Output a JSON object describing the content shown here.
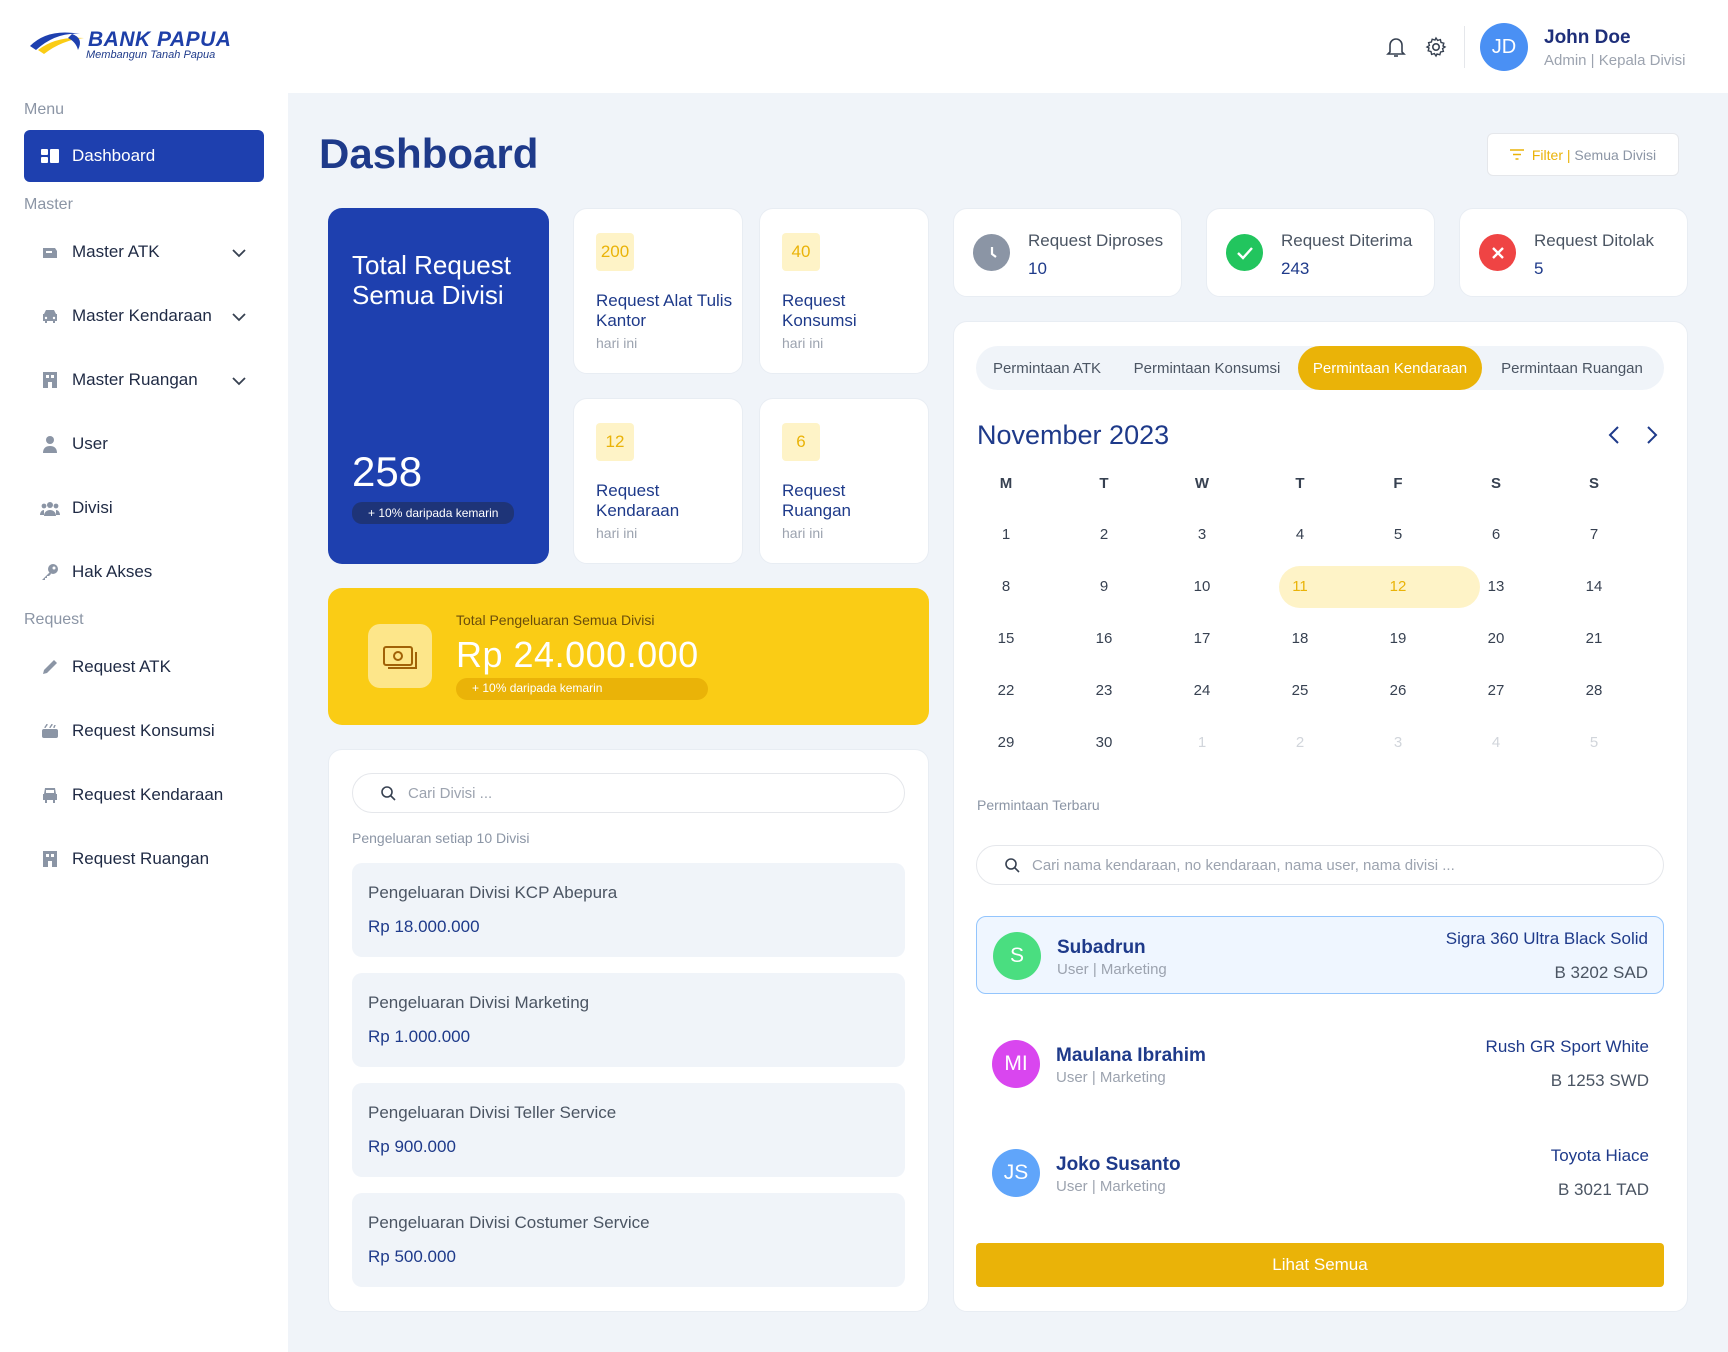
{
  "brand": {
    "name": "BANK PAPUA",
    "tagline": "Membangun Tanah Papua"
  },
  "user": {
    "initials": "JD",
    "name": "John Doe",
    "role": "Admin | Kepala Divisi"
  },
  "sidebar": {
    "menu_label": "Menu",
    "master_label": "Master",
    "request_label": "Request",
    "dashboard": "Dashboard",
    "master_items": [
      {
        "label": "Master ATK",
        "icon": "stapler-icon"
      },
      {
        "label": "Master Kendaraan",
        "icon": "car-icon"
      },
      {
        "label": "Master Ruangan",
        "icon": "building-icon"
      },
      {
        "label": "User",
        "icon": "user-icon"
      },
      {
        "label": "Divisi",
        "icon": "group-icon"
      },
      {
        "label": "Hak Akses",
        "icon": "key-icon"
      }
    ],
    "request_items": [
      {
        "label": "Request ATK",
        "icon": "pencil-icon"
      },
      {
        "label": "Request Konsumsi",
        "icon": "food-icon"
      },
      {
        "label": "Request Kendaraan",
        "icon": "car-icon"
      },
      {
        "label": "Request Ruangan",
        "icon": "building-icon"
      }
    ]
  },
  "page": {
    "title": "Dashboard",
    "filter_label": "Filter",
    "filter_value": "Semua Divisi"
  },
  "total": {
    "title": "Total Request Semua Divisi",
    "value": "258",
    "delta": "+ 10% daripada kemarin"
  },
  "mini_cards": [
    {
      "count": "200",
      "label": "Request Alat Tulis Kantor",
      "sub": "hari ini"
    },
    {
      "count": "40",
      "label": "Request Konsumsi",
      "sub": "hari ini"
    },
    {
      "count": "12",
      "label": "Request Kendaraan",
      "sub": "hari ini"
    },
    {
      "count": "6",
      "label": "Request Ruangan",
      "sub": "hari ini"
    }
  ],
  "stats": [
    {
      "label": "Request Diproses",
      "value": "10",
      "icon": "clock-icon",
      "color": "#8b95a5"
    },
    {
      "label": "Request Diterima",
      "value": "243",
      "icon": "check-icon",
      "color": "#22c55e"
    },
    {
      "label": "Request Ditolak",
      "value": "5",
      "icon": "x-icon",
      "color": "#ef4444"
    }
  ],
  "spending": {
    "title": "Total Pengeluaran Semua Divisi",
    "value": "Rp 24.000.000",
    "delta": "+ 10% daripada kemarin"
  },
  "divisions": {
    "search_placeholder": "Cari Divisi ...",
    "caption": "Pengeluaran setiap 10 Divisi",
    "items": [
      {
        "name": "Pengeluaran Divisi KCP Abepura",
        "amount": "Rp 18.000.000"
      },
      {
        "name": "Pengeluaran Divisi Marketing",
        "amount": "Rp 1.000.000"
      },
      {
        "name": "Pengeluaran Divisi Teller Service",
        "amount": "Rp 900.000"
      },
      {
        "name": "Pengeluaran Divisi Costumer Service",
        "amount": "Rp 500.000"
      }
    ]
  },
  "tabs": [
    "Permintaan ATK",
    "Permintaan Konsumsi",
    "Permintaan Kendaraan",
    "Permintaan Ruangan"
  ],
  "active_tab": "Permintaan Kendaraan",
  "calendar": {
    "month": "November 2023",
    "weekdays": [
      "M",
      "T",
      "W",
      "T",
      "F",
      "S",
      "S"
    ],
    "weeks": [
      [
        "1",
        "2",
        "3",
        "4",
        "5",
        "6",
        "7"
      ],
      [
        "8",
        "9",
        "10",
        "11",
        "12",
        "13",
        "14"
      ],
      [
        "15",
        "16",
        "17",
        "18",
        "19",
        "20",
        "21"
      ],
      [
        "22",
        "23",
        "24",
        "25",
        "26",
        "27",
        "28"
      ],
      [
        "29",
        "30",
        "1",
        "2",
        "3",
        "4",
        "5"
      ]
    ],
    "highlighted": [
      "11",
      "12"
    ]
  },
  "recent": {
    "label": "Permintaan Terbaru",
    "search_placeholder": "Cari nama kendaraan, no kendaraan, nama user, nama divisi ...",
    "items": [
      {
        "initials": "S",
        "name": "Subadrun",
        "role": "User | Marketing",
        "vehicle": "Sigra 360 Ultra Black Solid",
        "plate": "B 3202 SAD",
        "color": "#4ade80"
      },
      {
        "initials": "MI",
        "name": "Maulana Ibrahim",
        "role": "User | Marketing",
        "vehicle": "Rush GR Sport White",
        "plate": "B 1253 SWD",
        "color": "#d946ef"
      },
      {
        "initials": "JS",
        "name": "Joko Susanto",
        "role": "User | Marketing",
        "vehicle": "Toyota Hiace",
        "plate": "B 3021 TAD",
        "color": "#60a5fa"
      }
    ],
    "button": "Lihat Semua"
  }
}
